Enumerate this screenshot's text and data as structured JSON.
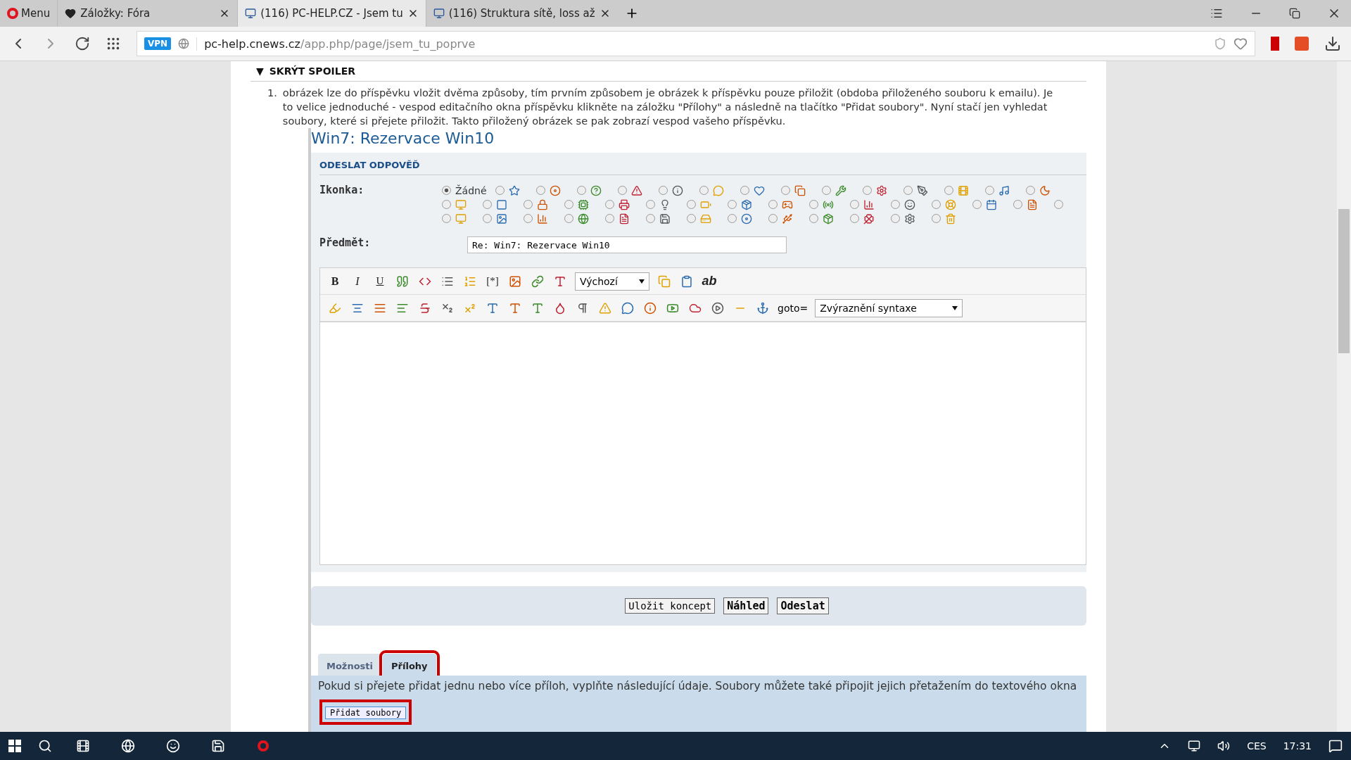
{
  "browser": {
    "menu": "Menu",
    "tabs": [
      {
        "title": "Záložky: Fóra",
        "kind": "bookmarks",
        "selected": false
      },
      {
        "title": "(116) PC-HELP.CZ - Jsem tu",
        "kind": "page",
        "selected": true
      },
      {
        "title": "(116) Struktura sítě, loss až",
        "kind": "page",
        "selected": false
      }
    ],
    "vpn": "VPN",
    "url_host": "pc-help.cnews.cz",
    "url_path": "/app.php/page/jsem_tu_poprve"
  },
  "spoiler": {
    "toggle": "▼",
    "title": "SKRÝT SPOILER",
    "item_number": "1.",
    "text": "obrázek lze do příspěvku vložit dvěma způsoby, tím prvním způsobem je obrázek k příspěvku pouze přiložit (obdoba přiloženého souboru k emailu). Je to velice jednoduché - vespod editačního okna příspěvku klikněte na záložku \"Přílohy\" a následně na tlačítko \"Přidat soubory\". Nyní stačí jen vyhledat soubory, které si přejete přiložit. Takto přiložený obrázek se pak zobrazí vespod vašeho příspěvku."
  },
  "post": {
    "title": "Win7: Rezervace Win10",
    "section": "ODESLAT ODPOVĚĎ",
    "icon_label": "Ikonka:",
    "icon_rows": [
      {
        "options": [
          {
            "kind": "label",
            "label": "Žádné",
            "selected": true
          },
          {
            "kind": "icon",
            "selected": false
          },
          {
            "kind": "icon",
            "selected": false
          },
          {
            "kind": "icon",
            "selected": false
          },
          {
            "kind": "icon",
            "selected": false
          },
          {
            "kind": "icon",
            "selected": false
          },
          {
            "kind": "icon",
            "selected": false
          },
          {
            "kind": "icon",
            "selected": false
          },
          {
            "kind": "icon",
            "selected": false
          },
          {
            "kind": "icon",
            "selected": false
          },
          {
            "kind": "icon",
            "selected": false
          },
          {
            "kind": "icon",
            "selected": false
          },
          {
            "kind": "icon",
            "selected": false
          },
          {
            "kind": "icon",
            "selected": false
          },
          {
            "kind": "icon",
            "selected": false
          }
        ]
      },
      {
        "options": [
          {
            "kind": "icon",
            "selected": false
          },
          {
            "kind": "icon",
            "selected": false
          },
          {
            "kind": "icon",
            "selected": false
          },
          {
            "kind": "icon",
            "selected": false
          },
          {
            "kind": "icon",
            "selected": false
          },
          {
            "kind": "icon",
            "selected": false
          },
          {
            "kind": "icon",
            "selected": false
          },
          {
            "kind": "icon",
            "selected": false
          },
          {
            "kind": "icon",
            "selected": false
          },
          {
            "kind": "icon",
            "selected": false
          },
          {
            "kind": "icon",
            "selected": false
          },
          {
            "kind": "icon",
            "selected": false
          },
          {
            "kind": "icon",
            "selected": false
          },
          {
            "kind": "icon",
            "selected": false
          },
          {
            "kind": "icon",
            "selected": false
          },
          {
            "kind": "bare",
            "selected": false
          }
        ]
      },
      {
        "options": [
          {
            "kind": "icon",
            "selected": false
          },
          {
            "kind": "icon",
            "selected": false
          },
          {
            "kind": "icon",
            "selected": false
          },
          {
            "kind": "icon",
            "selected": false
          },
          {
            "kind": "icon",
            "selected": false
          },
          {
            "kind": "icon",
            "selected": false
          },
          {
            "kind": "icon",
            "selected": false
          },
          {
            "kind": "icon",
            "selected": false
          },
          {
            "kind": "icon",
            "selected": false
          },
          {
            "kind": "icon",
            "selected": false
          },
          {
            "kind": "icon",
            "selected": false
          },
          {
            "kind": "icon",
            "selected": false
          },
          {
            "kind": "icon",
            "selected": false
          }
        ]
      }
    ],
    "subject_label": "Předmět:",
    "subject_value": "Re: Win7: Rezervace Win10",
    "toolbar_rows": [
      [
        {
          "kind": "text",
          "text": "B"
        },
        {
          "kind": "text",
          "text": "I"
        },
        {
          "kind": "text",
          "text": "U"
        },
        {
          "kind": "icon"
        },
        {
          "kind": "icon"
        },
        {
          "kind": "icon"
        },
        {
          "kind": "icon"
        },
        {
          "kind": "text",
          "text": "[*]"
        },
        {
          "kind": "icon"
        },
        {
          "kind": "icon"
        },
        {
          "kind": "icon"
        },
        {
          "kind": "select",
          "text": "Výchozí"
        },
        {
          "kind": "icon"
        },
        {
          "kind": "icon"
        },
        {
          "kind": "text",
          "text": "ab"
        }
      ],
      [
        {
          "kind": "icon"
        },
        {
          "kind": "icon"
        },
        {
          "kind": "icon"
        },
        {
          "kind": "icon"
        },
        {
          "kind": "icon"
        },
        {
          "kind": "icon"
        },
        {
          "kind": "icon"
        },
        {
          "kind": "icon"
        },
        {
          "kind": "icon"
        },
        {
          "kind": "icon"
        },
        {
          "kind": "icon"
        },
        {
          "kind": "icon"
        },
        {
          "kind": "icon"
        },
        {
          "kind": "icon"
        },
        {
          "kind": "icon"
        },
        {
          "kind": "icon"
        },
        {
          "kind": "icon"
        },
        {
          "kind": "icon"
        },
        {
          "kind": "icon"
        },
        {
          "kind": "icon"
        },
        {
          "kind": "label",
          "text": "goto="
        },
        {
          "kind": "select",
          "text": "Zvýraznění syntaxe"
        }
      ]
    ],
    "buttons": [
      {
        "label": "Uložit koncept",
        "primary": false
      },
      {
        "label": "Náhled",
        "primary": true
      },
      {
        "label": "Odeslat",
        "primary": true
      }
    ],
    "tabs": [
      {
        "label": "Možnosti",
        "selected": false,
        "highlighted": false
      },
      {
        "label": "Přílohy",
        "selected": true,
        "highlighted": true
      }
    ],
    "attach_text": "Pokud si přejete přidat jednu nebo více příloh, vyplňte následující údaje. Soubory můžete také připojit jejich přetažením do textového okna",
    "attach_button": {
      "label": "Přidat soubory",
      "highlighted": true
    }
  },
  "taskbar": {
    "language": "CES",
    "time": "17:31"
  }
}
